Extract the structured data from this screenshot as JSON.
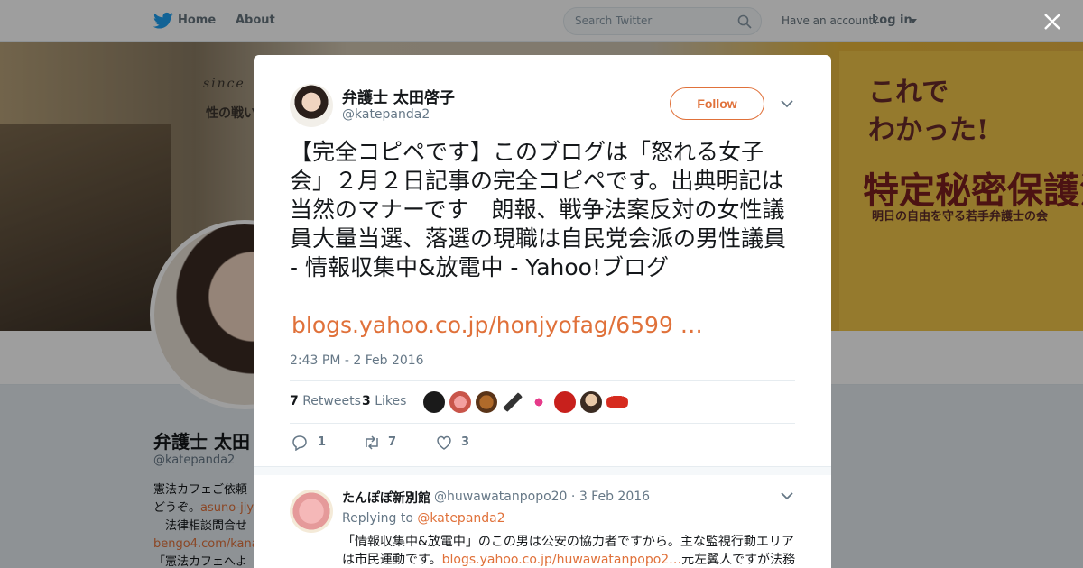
{
  "nav": {
    "home": "Home",
    "about": "About",
    "search_placeholder": "Search Twitter",
    "have_account": "Have an account?",
    "login": "Log in"
  },
  "background_profile": {
    "banner_text_1": "since",
    "banner_text_2": "性の戦い",
    "book_title_1": "これで",
    "book_title_1b": "わかった!",
    "book_title_2": "特定秘密保護法",
    "book_subtitle": "明日の自由を守る若手弁護士の会",
    "name": "弁護士 太田",
    "handle": "@katepanda2",
    "bio_line1": "憲法カフェご依頼",
    "bio_line2a": "どうぞ。",
    "bio_line2_link": "asuno-jiy",
    "bio_line3": "　法律相談問合せ",
    "bio_line4_link": "bengo4.com/kana",
    "bio_line5": "「憲法カフェへよ"
  },
  "tweet": {
    "author_name": "弁護士 太田啓子",
    "author_handle": "@katepanda2",
    "follow_label": "Follow",
    "text": "【完全コピペです】このブログは「怒れる女子会」２月２日記事の完全コピペです。出典明記は当然のマナーです　朗報、戦争法案反対の女性議員大量当選、落選の現職は自民党会派の男性議員 - 情報収集中&放電中 - Yahoo!ブログ",
    "link": "blogs.yahoo.co.jp/honjyofag/6599 …",
    "timestamp": "2:43 PM - 2 Feb 2016",
    "retweets_count": "7",
    "retweets_label": "Retweets",
    "likes_count": "3",
    "likes_label": "Likes",
    "reply_count": "1",
    "retweet_action_count": "7",
    "like_action_count": "3"
  },
  "reply": {
    "name": "たんぽぽ新別館",
    "handle": "@huwawatanpopo20",
    "date": "· 3 Feb 2016",
    "replying_to_label": "Replying to",
    "replying_to_handle": "@katepanda2",
    "text_part1": "「情報収集中&放電中」のこの男は公安の協力者ですから。主な監視行動エリアは市民運動です。",
    "text_link": "blogs.yahoo.co.jp/huwawatanpopo2…",
    "text_part2": "元左翼人ですが法務省"
  },
  "colors": {
    "accent": "#e0713a",
    "twitter_blue": "#1da1f2",
    "muted": "#657786"
  }
}
